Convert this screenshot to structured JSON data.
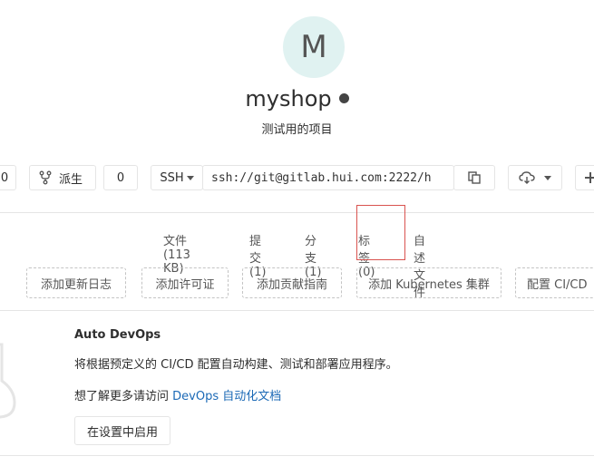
{
  "project": {
    "avatar_letter": "M",
    "name": "myshop",
    "description": "测试用的项目"
  },
  "actions": {
    "star_count": "0",
    "fork_label": "派生",
    "fork_count": "0",
    "clone_protocol": "SSH",
    "clone_url": "ssh://git@gitlab.hui.com:2222/h"
  },
  "stats": {
    "files": "文件(113 KB)",
    "commits": "提交(1)",
    "branches": "分支(1)",
    "tags": "标签(0)",
    "readme": "自述文件"
  },
  "suggestions": {
    "changelog": "添加更新日志",
    "license": "添加许可证",
    "contributing": "添加贡献指南",
    "kubernetes": "添加 Kubernetes 集群",
    "cicd": "配置 CI/CD"
  },
  "devops": {
    "title": "Auto DevOps",
    "description": "将根据预定义的 CI/CD 配置自动构建、测试和部署应用程序。",
    "learn_more_prefix": "想了解更多请访问 ",
    "learn_more_link": "DevOps 自动化文档",
    "enable_button": "在设置中启用"
  },
  "colors": {
    "link": "#1b69b6",
    "highlight_border": "#d9534f",
    "avatar_bg": "#e0f2f1"
  }
}
